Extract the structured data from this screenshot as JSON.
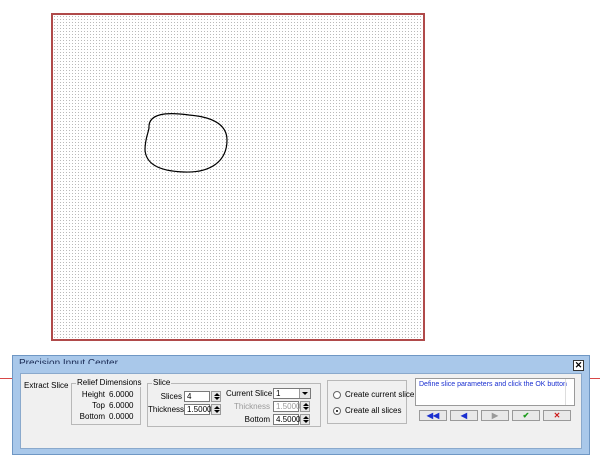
{
  "palette": {
    "title": "Precision Input Center",
    "close": "✕"
  },
  "extract_label": "Extract Slice",
  "relief": {
    "title": "Relief Dimensions",
    "height_label": "Height",
    "height_value": "6.0000",
    "top_label": "Top",
    "top_value": "6.0000",
    "bottom_label": "Bottom",
    "bottom_value": "0.0000"
  },
  "slice": {
    "title": "Slice",
    "slices_label": "Slices",
    "slices_value": "4",
    "thickness_label": "Thickness",
    "thickness_value": "1.5000"
  },
  "current_slice": {
    "label": "Current Slice",
    "value": "1",
    "thickness_label": "Thickness",
    "thickness_value": "1.5000",
    "bottom_label": "Bottom",
    "bottom_value": "4.5000"
  },
  "options": {
    "create_current": "Create current slice",
    "create_all": "Create all slices",
    "selected": "create_all"
  },
  "message": "Define slice parameters and click the OK button",
  "nav": {
    "first": "◀◀",
    "prev": "◀",
    "next": "▶",
    "ok": "✔",
    "cancel": "✕"
  },
  "colors": {
    "ok": "#1a9a1a",
    "cancel": "#cc1a1a",
    "nav": "#1a2fd0",
    "message": "#1a2fd0"
  }
}
